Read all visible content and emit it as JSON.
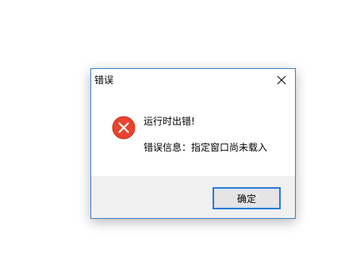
{
  "dialog": {
    "title": "错误",
    "close_icon": "close-icon",
    "icon": "error-icon",
    "message_line1": "运行时出错!",
    "message_line2": "错误信息：指定窗口尚未载入",
    "ok_label": "确定"
  },
  "colors": {
    "accent": "#2b7ad2",
    "error_red": "#e8432c",
    "footer_bg": "#f0f0f0"
  }
}
